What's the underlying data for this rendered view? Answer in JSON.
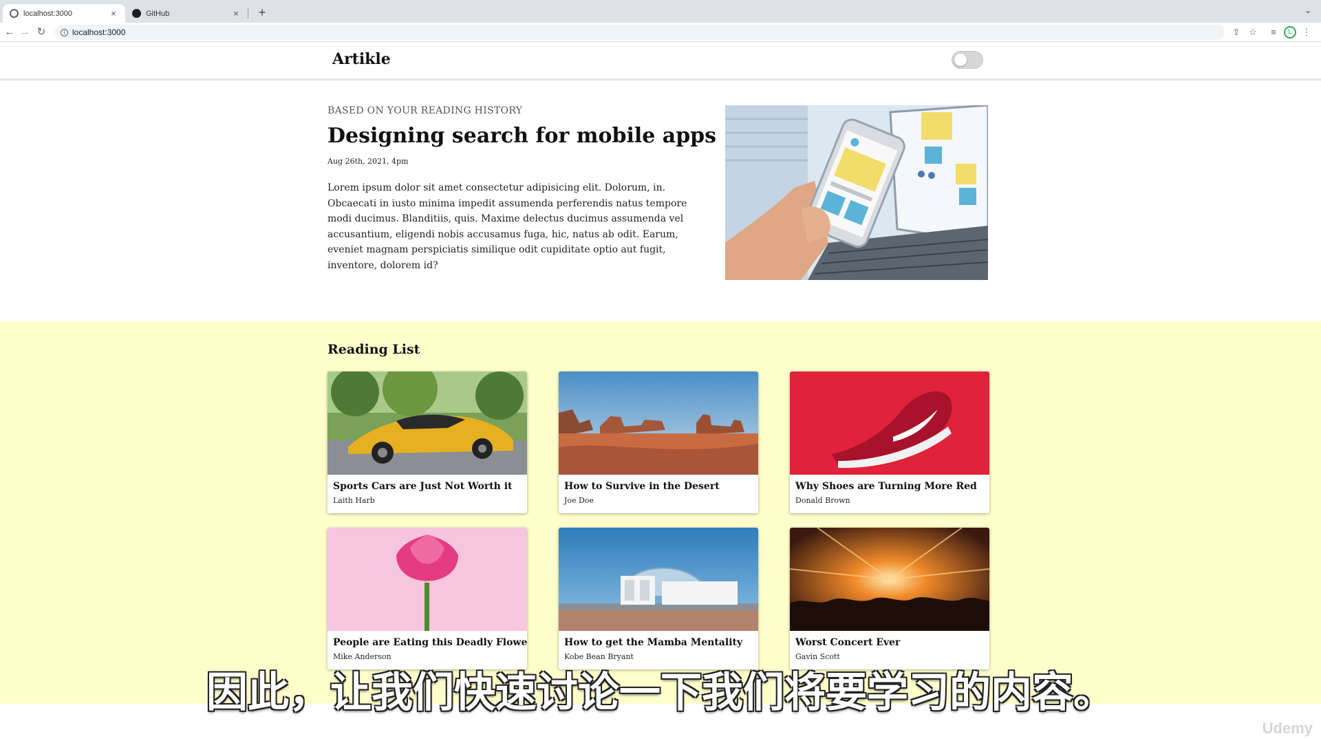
{
  "browser": {
    "tabs": [
      {
        "label": "localhost:3000",
        "active": true,
        "icon": "globe-icon"
      },
      {
        "label": "GitHub",
        "active": false,
        "icon": "github-icon"
      }
    ],
    "url": "localhost:3000",
    "colors": {
      "tabbar": "#dee1e6",
      "omnibox": "#f1f3f4"
    }
  },
  "header": {
    "logo": "Artikle",
    "theme_toggle": {
      "on": false
    }
  },
  "featured": {
    "eyebrow": "BASED ON YOUR READING HISTORY",
    "title": "Designing search for mobile apps",
    "date": "Aug 26th, 2021, 4pm",
    "body": "Lorem ipsum dolor sit amet consectetur adipisicing elit. Dolorum, in. Obcaecati in iusto minima impedit assumenda perferendis natus tempore modi ducimus. Blanditiis, quis. Maxime delectus ducimus assumenda vel accusantium, eligendi nobis accusamus fuga, hic, natus ab odit. Earum, eveniet magnam perspiciatis similique odit cupiditate optio aut fugit, inventore, dolorem id?"
  },
  "reading_list": {
    "title": "Reading List",
    "background": "#ffffcc",
    "articles": [
      {
        "title": "Sports Cars are Just Not Worth it",
        "author": "Laith Harb"
      },
      {
        "title": "How to Survive in the Desert",
        "author": "Joe Doe"
      },
      {
        "title": "Why Shoes are Turning More Red",
        "author": "Donald Brown"
      },
      {
        "title": "People are Eating this Deadly Flower",
        "author": "Mike Anderson"
      },
      {
        "title": "How to get the Mamba Mentality",
        "author": "Kobe Bean Bryant"
      },
      {
        "title": "Worst Concert Ever",
        "author": "Gavin Scott"
      }
    ]
  },
  "overlay": {
    "subtitle": "因此，让我们快速讨论一下我们将要学习的内容。",
    "watermark": "Udemy"
  }
}
